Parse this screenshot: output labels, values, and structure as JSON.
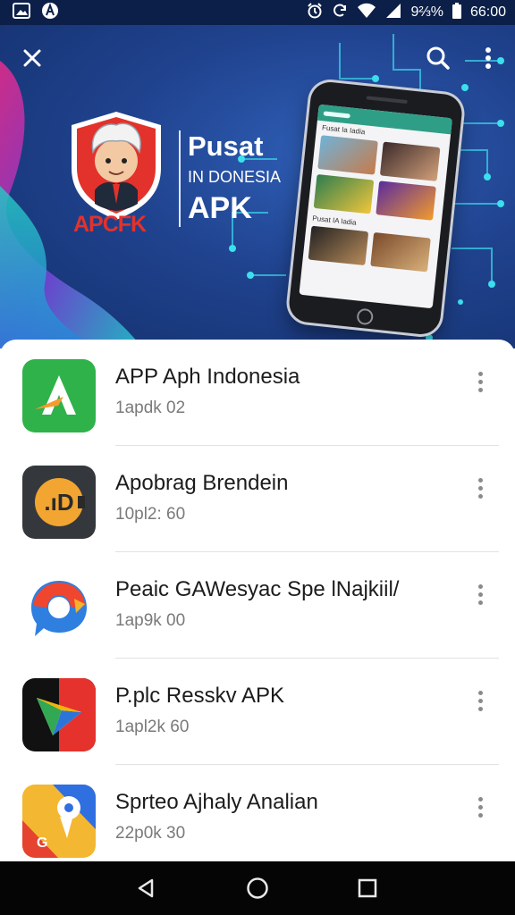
{
  "status_bar": {
    "battery_percent": "9⅔%",
    "time": "66:00",
    "icons": [
      "image-icon",
      "app-notification-icon",
      "alarm-icon",
      "sync-icon",
      "wifi-icon",
      "signal-icon",
      "battery-icon"
    ]
  },
  "header": {
    "close_icon": "close-icon",
    "search_icon": "search-icon",
    "more_icon": "more-vert-icon"
  },
  "banner": {
    "logo_text": "APCFK",
    "title_line1": "Pusat",
    "title_line2": "IN DONESIA",
    "title_line3": "APK",
    "phone_screen_label": "Fusat Ia Iadia",
    "phone_screen_label2": "Pusat IA Iadia"
  },
  "apps": [
    {
      "name": "APP Aph Indonesia",
      "meta": "1apdk 02",
      "icon": "green-a-app-icon"
    },
    {
      "name": "Apobrag Brendein",
      "meta": "10pl2: 60",
      "icon": "orange-d-app-icon"
    },
    {
      "name": "Peaic GAWesyac Spe lNajkiil/",
      "meta": "1ap9k 00",
      "icon": "chat-bubble-app-icon"
    },
    {
      "name": "P.plc Resskv APK",
      "meta": "1apl2k 60",
      "icon": "play-arrow-app-icon"
    },
    {
      "name": "Sprteo Ajhaly Analian",
      "meta": "22p0k 30",
      "icon": "maps-pin-app-icon"
    }
  ],
  "navigation": {
    "back": "back-icon",
    "home": "home-icon",
    "recents": "recents-icon"
  },
  "colors": {
    "status_bar": "#0c1f49",
    "banner_blue": "#20438f",
    "logo_red": "#e2322b",
    "nav_bar": "#050505"
  }
}
